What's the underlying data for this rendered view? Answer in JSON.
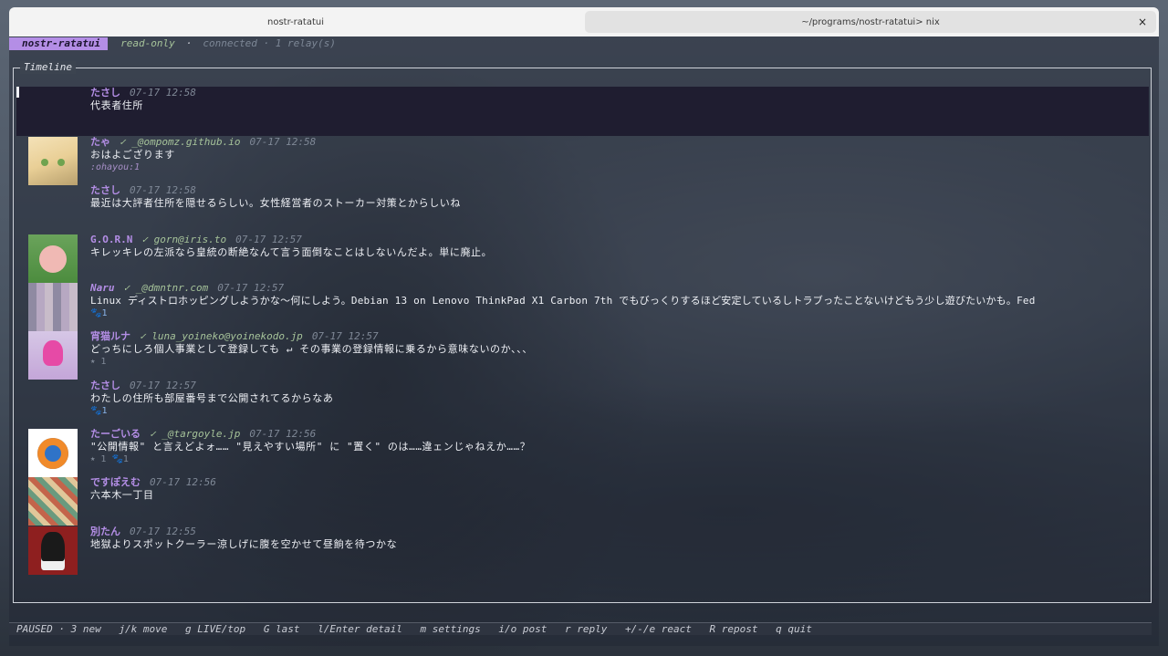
{
  "tabs": [
    {
      "label": "nostr-ratatui"
    },
    {
      "label": "~/programs/nostr-ratatui> nix",
      "close": "×"
    }
  ],
  "header": {
    "app": "nostr-ratatui",
    "mode": "read-only",
    "sep": "·",
    "connection": "connected · 1 relay(s)"
  },
  "timeline": {
    "title": "Timeline",
    "items": [
      {
        "name": "たさし",
        "nip": "",
        "time": "07-17 12:58",
        "text": "代表者住所",
        "extra": ""
      },
      {
        "name": "たゃ",
        "nip": "✓ _@ompomz.github.io",
        "time": "07-17 12:58",
        "text": "おはよござります",
        "extra": ":ohayou:1"
      },
      {
        "name": "たさし",
        "nip": "",
        "time": "07-17 12:58",
        "text": "最近は大評者住所を隠せるらしい。女性経営者のストーカー対策とからしいね",
        "extra": ""
      },
      {
        "name": "G.O.R.N",
        "nip": "✓ gorn@iris.to",
        "time": "07-17 12:57",
        "text": "キレッキレの左派なら皇統の断絶なんて言う面倒なことはしないんだよ。単に廃止。",
        "extra": ""
      },
      {
        "name": "Naru",
        "nip": "✓ _@dmntnr.com",
        "time": "07-17 12:57",
        "text": "Linux ディストロホッピングしようかな～何にしよう。Debian 13 on Lenovo ThinkPad X1 Carbon 7th でもびっくりするほど安定しているしトラブったことないけどもう少し遊びたいかも。Fed",
        "extra": "🐾1"
      },
      {
        "name": "宵猫ルナ",
        "nip": "✓ luna_yoineko@yoinekodo.jp",
        "time": "07-17 12:57",
        "text": "どっちにしろ個人事業として登録しても ↵ その事業の登録情報に乗るから意味ないのか、、、",
        "extra": "⭑ 1"
      },
      {
        "name": "たさし",
        "nip": "",
        "time": "07-17 12:57",
        "text": "わたしの住所も部屋番号まで公開されてるからなあ",
        "extra": "🐾1"
      },
      {
        "name": "たーごいる",
        "nip": "✓ _@targoyle.jp",
        "time": "07-17 12:56",
        "text": "\"公開情報\" と言えどよォ…… \"見えやすい場所\" に \"置く\" のは……違ェンじゃねえか……？",
        "extra": "⭑ 1 🐾1"
      },
      {
        "name": "ですぽえむ",
        "nip": "",
        "time": "07-17 12:56",
        "text": "六本木一丁目",
        "extra": ""
      },
      {
        "name": "別たん",
        "nip": "",
        "time": "07-17 12:55",
        "text": "地獄よりスポットクーラー涼しげに腹を空かせて昼餉を待つかな",
        "extra": ""
      }
    ]
  },
  "statusbar": {
    "items": [
      "PAUSED · 3 new",
      "j/k move",
      "g LIVE/top",
      "G last",
      "l/Enter detail",
      "m settings",
      "i/o post",
      "r reply",
      "+/-/e react",
      "R repost",
      "q quit"
    ]
  }
}
